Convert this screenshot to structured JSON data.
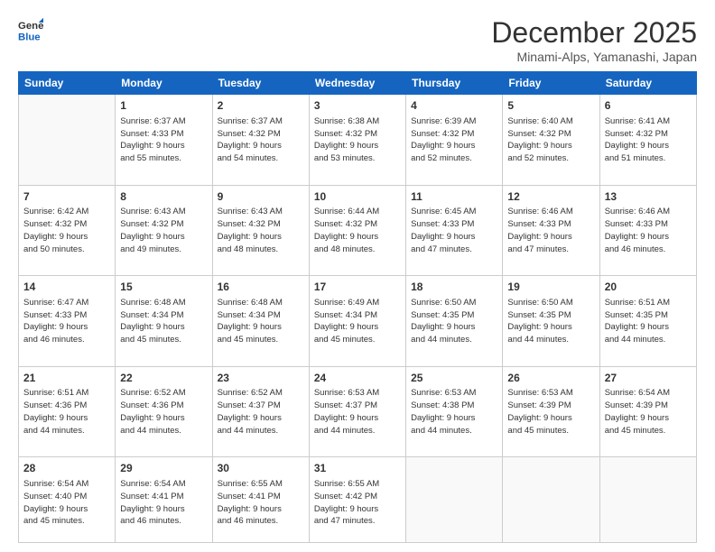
{
  "logo": {
    "line1": "General",
    "line2": "Blue"
  },
  "header": {
    "month": "December 2025",
    "location": "Minami-Alps, Yamanashi, Japan"
  },
  "days_of_week": [
    "Sunday",
    "Monday",
    "Tuesday",
    "Wednesday",
    "Thursday",
    "Friday",
    "Saturday"
  ],
  "weeks": [
    [
      {
        "day": "",
        "info": ""
      },
      {
        "day": "1",
        "info": "Sunrise: 6:37 AM\nSunset: 4:33 PM\nDaylight: 9 hours\nand 55 minutes."
      },
      {
        "day": "2",
        "info": "Sunrise: 6:37 AM\nSunset: 4:32 PM\nDaylight: 9 hours\nand 54 minutes."
      },
      {
        "day": "3",
        "info": "Sunrise: 6:38 AM\nSunset: 4:32 PM\nDaylight: 9 hours\nand 53 minutes."
      },
      {
        "day": "4",
        "info": "Sunrise: 6:39 AM\nSunset: 4:32 PM\nDaylight: 9 hours\nand 52 minutes."
      },
      {
        "day": "5",
        "info": "Sunrise: 6:40 AM\nSunset: 4:32 PM\nDaylight: 9 hours\nand 52 minutes."
      },
      {
        "day": "6",
        "info": "Sunrise: 6:41 AM\nSunset: 4:32 PM\nDaylight: 9 hours\nand 51 minutes."
      }
    ],
    [
      {
        "day": "7",
        "info": "Sunrise: 6:42 AM\nSunset: 4:32 PM\nDaylight: 9 hours\nand 50 minutes."
      },
      {
        "day": "8",
        "info": "Sunrise: 6:43 AM\nSunset: 4:32 PM\nDaylight: 9 hours\nand 49 minutes."
      },
      {
        "day": "9",
        "info": "Sunrise: 6:43 AM\nSunset: 4:32 PM\nDaylight: 9 hours\nand 48 minutes."
      },
      {
        "day": "10",
        "info": "Sunrise: 6:44 AM\nSunset: 4:32 PM\nDaylight: 9 hours\nand 48 minutes."
      },
      {
        "day": "11",
        "info": "Sunrise: 6:45 AM\nSunset: 4:33 PM\nDaylight: 9 hours\nand 47 minutes."
      },
      {
        "day": "12",
        "info": "Sunrise: 6:46 AM\nSunset: 4:33 PM\nDaylight: 9 hours\nand 47 minutes."
      },
      {
        "day": "13",
        "info": "Sunrise: 6:46 AM\nSunset: 4:33 PM\nDaylight: 9 hours\nand 46 minutes."
      }
    ],
    [
      {
        "day": "14",
        "info": "Sunrise: 6:47 AM\nSunset: 4:33 PM\nDaylight: 9 hours\nand 46 minutes."
      },
      {
        "day": "15",
        "info": "Sunrise: 6:48 AM\nSunset: 4:34 PM\nDaylight: 9 hours\nand 45 minutes."
      },
      {
        "day": "16",
        "info": "Sunrise: 6:48 AM\nSunset: 4:34 PM\nDaylight: 9 hours\nand 45 minutes."
      },
      {
        "day": "17",
        "info": "Sunrise: 6:49 AM\nSunset: 4:34 PM\nDaylight: 9 hours\nand 45 minutes."
      },
      {
        "day": "18",
        "info": "Sunrise: 6:50 AM\nSunset: 4:35 PM\nDaylight: 9 hours\nand 44 minutes."
      },
      {
        "day": "19",
        "info": "Sunrise: 6:50 AM\nSunset: 4:35 PM\nDaylight: 9 hours\nand 44 minutes."
      },
      {
        "day": "20",
        "info": "Sunrise: 6:51 AM\nSunset: 4:35 PM\nDaylight: 9 hours\nand 44 minutes."
      }
    ],
    [
      {
        "day": "21",
        "info": "Sunrise: 6:51 AM\nSunset: 4:36 PM\nDaylight: 9 hours\nand 44 minutes."
      },
      {
        "day": "22",
        "info": "Sunrise: 6:52 AM\nSunset: 4:36 PM\nDaylight: 9 hours\nand 44 minutes."
      },
      {
        "day": "23",
        "info": "Sunrise: 6:52 AM\nSunset: 4:37 PM\nDaylight: 9 hours\nand 44 minutes."
      },
      {
        "day": "24",
        "info": "Sunrise: 6:53 AM\nSunset: 4:37 PM\nDaylight: 9 hours\nand 44 minutes."
      },
      {
        "day": "25",
        "info": "Sunrise: 6:53 AM\nSunset: 4:38 PM\nDaylight: 9 hours\nand 44 minutes."
      },
      {
        "day": "26",
        "info": "Sunrise: 6:53 AM\nSunset: 4:39 PM\nDaylight: 9 hours\nand 45 minutes."
      },
      {
        "day": "27",
        "info": "Sunrise: 6:54 AM\nSunset: 4:39 PM\nDaylight: 9 hours\nand 45 minutes."
      }
    ],
    [
      {
        "day": "28",
        "info": "Sunrise: 6:54 AM\nSunset: 4:40 PM\nDaylight: 9 hours\nand 45 minutes."
      },
      {
        "day": "29",
        "info": "Sunrise: 6:54 AM\nSunset: 4:41 PM\nDaylight: 9 hours\nand 46 minutes."
      },
      {
        "day": "30",
        "info": "Sunrise: 6:55 AM\nSunset: 4:41 PM\nDaylight: 9 hours\nand 46 minutes."
      },
      {
        "day": "31",
        "info": "Sunrise: 6:55 AM\nSunset: 4:42 PM\nDaylight: 9 hours\nand 47 minutes."
      },
      {
        "day": "",
        "info": ""
      },
      {
        "day": "",
        "info": ""
      },
      {
        "day": "",
        "info": ""
      }
    ]
  ]
}
